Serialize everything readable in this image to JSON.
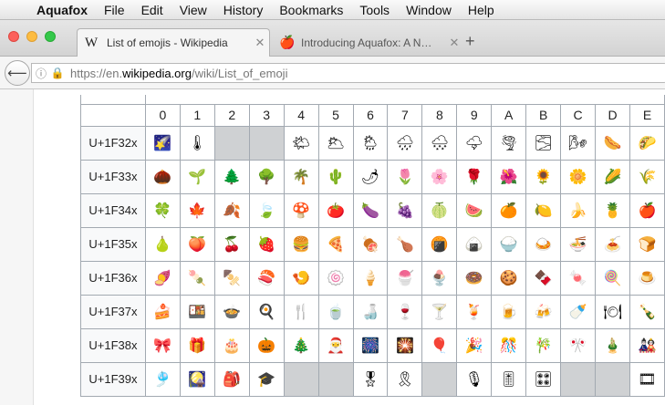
{
  "menubar": {
    "app_name": "Aquafox",
    "items": [
      "File",
      "Edit",
      "View",
      "History",
      "Bookmarks",
      "Tools",
      "Window",
      "Help"
    ]
  },
  "tabs": [
    {
      "favicon": "W",
      "title": "List of emojis - Wikipedia",
      "close": "✕"
    },
    {
      "favicon": "🍎",
      "title": "Introducing Aquafox: A N…",
      "close": "✕"
    }
  ],
  "new_tab": "+",
  "address": {
    "protocol": "https://en.",
    "domain": "wikipedia.org",
    "path": "/wiki/List_of_emoji"
  },
  "emoji_table": {
    "columns": [
      "0",
      "1",
      "2",
      "3",
      "4",
      "5",
      "6",
      "7",
      "8",
      "9",
      "A",
      "B",
      "C",
      "D",
      "E"
    ],
    "rows": [
      {
        "label": "U+1F32x",
        "cells": [
          "🌠",
          "🌡",
          "",
          "",
          "🌤",
          "🌥",
          "🌦",
          "🌧",
          "🌨",
          "🌩",
          "🌪",
          "🌫",
          "🌬",
          "🌭",
          "🌮"
        ]
      },
      {
        "label": "U+1F33x",
        "cells": [
          "🌰",
          "🌱",
          "🌲",
          "🌳",
          "🌴",
          "🌵",
          "🌶",
          "🌷",
          "🌸",
          "🌹",
          "🌺",
          "🌻",
          "🌼",
          "🌽",
          "🌾"
        ]
      },
      {
        "label": "U+1F34x",
        "cells": [
          "🍀",
          "🍁",
          "🍂",
          "🍃",
          "🍄",
          "🍅",
          "🍆",
          "🍇",
          "🍈",
          "🍉",
          "🍊",
          "🍋",
          "🍌",
          "🍍",
          "🍎"
        ]
      },
      {
        "label": "U+1F35x",
        "cells": [
          "🍐",
          "🍑",
          "🍒",
          "🍓",
          "🍔",
          "🍕",
          "🍖",
          "🍗",
          "🍘",
          "🍙",
          "🍚",
          "🍛",
          "🍜",
          "🍝",
          "🍞"
        ]
      },
      {
        "label": "U+1F36x",
        "cells": [
          "🍠",
          "🍡",
          "🍢",
          "🍣",
          "🍤",
          "🍥",
          "🍦",
          "🍧",
          "🍨",
          "🍩",
          "🍪",
          "🍫",
          "🍬",
          "🍭",
          "🍮"
        ]
      },
      {
        "label": "U+1F37x",
        "cells": [
          "🍰",
          "🍱",
          "🍲",
          "🍳",
          "🍴",
          "🍵",
          "🍶",
          "🍷",
          "🍸",
          "🍹",
          "🍺",
          "🍻",
          "🍼",
          "🍽",
          "🍾"
        ]
      },
      {
        "label": "U+1F38x",
        "cells": [
          "🎀",
          "🎁",
          "🎂",
          "🎃",
          "🎄",
          "🎅",
          "🎆",
          "🎇",
          "🎈",
          "🎉",
          "🎊",
          "🎋",
          "🎌",
          "🎍",
          "🎎"
        ]
      },
      {
        "label": "U+1F39x",
        "cells": [
          "🎐",
          "🎑",
          "🎒",
          "🎓",
          "",
          "",
          "🎖",
          "🎗",
          "",
          "🎙",
          "🎚",
          "🎛",
          "",
          "",
          "🎞"
        ]
      }
    ]
  }
}
